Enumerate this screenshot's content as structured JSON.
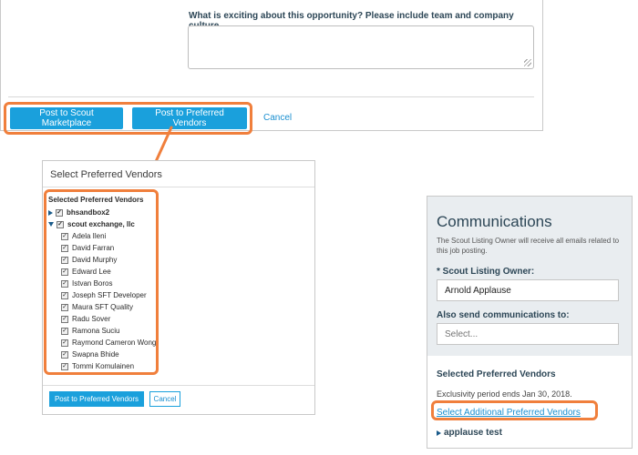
{
  "form": {
    "question_label": "What is exciting about this opportunity? Please include team and company culture.",
    "post_scout_label": "Post to Scout Marketplace",
    "post_preferred_label": "Post to Preferred Vendors",
    "cancel_label": "Cancel"
  },
  "modal": {
    "title": "Select Preferred Vendors",
    "header": "Selected Preferred Vendors",
    "groups": [
      {
        "name": "bhsandbox2",
        "expanded": false,
        "checked": true
      },
      {
        "name": "scout exchange, llc",
        "expanded": true,
        "checked": true
      }
    ],
    "vendors": [
      "Adela Ileni",
      "David Farran",
      "David Murphy",
      "Edward Lee",
      "Istvan Boros",
      "Joseph SFT Developer",
      "Maura SFT Quality",
      "Radu Sover",
      "Ramona Suciu",
      "Raymond Cameron Wong",
      "Swapna Bhide",
      "Tommi Komulainen"
    ],
    "post_label": "Post to Preferred Vendors",
    "cancel_label": "Cancel"
  },
  "comms": {
    "title": "Communications",
    "description": "The Scout Listing Owner will receive all emails related to this job posting.",
    "owner_label": "* Scout Listing Owner:",
    "owner_value": "Arnold Applause",
    "also_label": "Also send communications to:",
    "also_placeholder": "Select...",
    "section_title": "Selected Preferred Vendors",
    "exclusivity": "Exclusivity period ends Jan 30, 2018.",
    "select_link": "Select Additional Preferred Vendors",
    "vendor": "applause test"
  },
  "colors": {
    "highlight": "#f07f3c",
    "primary": "#1aa0dc",
    "heading": "#2c4656"
  },
  "icons": {
    "arrow": "arrow-down-left-icon",
    "caret_collapsed": "caret-right-icon",
    "caret_expanded": "caret-down-icon",
    "checkbox": "checkbox-checked-icon"
  }
}
